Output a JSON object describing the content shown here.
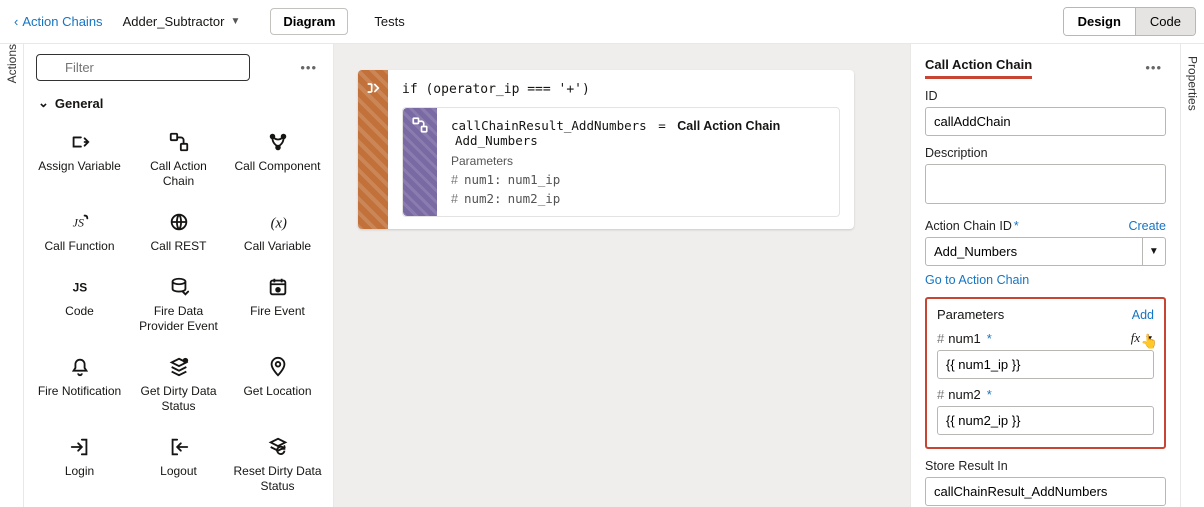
{
  "topbar": {
    "back_label": "Action Chains",
    "chain_name": "Adder_Subtractor",
    "diagram_label": "Diagram",
    "tests_label": "Tests",
    "design_label": "Design",
    "code_label": "Code"
  },
  "left_tab": "Actions",
  "right_tab": "Properties",
  "search": {
    "placeholder": "Filter"
  },
  "group_label": "General",
  "actions": [
    {
      "name": "assign-variable",
      "label": "Assign Variable"
    },
    {
      "name": "call-action-chain",
      "label": "Call Action Chain"
    },
    {
      "name": "call-component",
      "label": "Call Component"
    },
    {
      "name": "call-function",
      "label": "Call Function"
    },
    {
      "name": "call-rest",
      "label": "Call REST"
    },
    {
      "name": "call-variable",
      "label": "Call Variable"
    },
    {
      "name": "code",
      "label": "Code"
    },
    {
      "name": "fire-data-provider-event",
      "label": "Fire Data Provider Event"
    },
    {
      "name": "fire-event",
      "label": "Fire Event"
    },
    {
      "name": "fire-notification",
      "label": "Fire Notification"
    },
    {
      "name": "get-dirty-data-status",
      "label": "Get Dirty Data Status"
    },
    {
      "name": "get-location",
      "label": "Get Location"
    },
    {
      "name": "login",
      "label": "Login"
    },
    {
      "name": "logout",
      "label": "Logout"
    },
    {
      "name": "reset-dirty-data-status",
      "label": "Reset Dirty Data Status"
    }
  ],
  "flow": {
    "condition": "if (operator_ip === '+')",
    "inner": {
      "result_var": "callChainResult_AddNumbers",
      "eq": "=",
      "label_bold": "Call Action Chain",
      "chain_ref": "Add_Numbers",
      "params_head": "Parameters",
      "params": [
        {
          "name": "num1:",
          "value": "num1_ip"
        },
        {
          "name": "num2:",
          "value": "num2_ip"
        }
      ]
    }
  },
  "props": {
    "title": "Call Action Chain",
    "id_label": "ID",
    "id_value": "callAddChain",
    "desc_label": "Description",
    "desc_value": "",
    "chainid_label": "Action Chain ID",
    "create_label": "Create",
    "chainid_value": "Add_Numbers",
    "goto_label": "Go to Action Chain",
    "params_label": "Parameters",
    "add_label": "Add",
    "param1_name": "num1",
    "param1_value": "{{ num1_ip }}",
    "param2_name": "num2",
    "param2_value": "{{ num2_ip }}",
    "store_label": "Store Result In",
    "store_value": "callChainResult_AddNumbers",
    "fx": "fx"
  }
}
